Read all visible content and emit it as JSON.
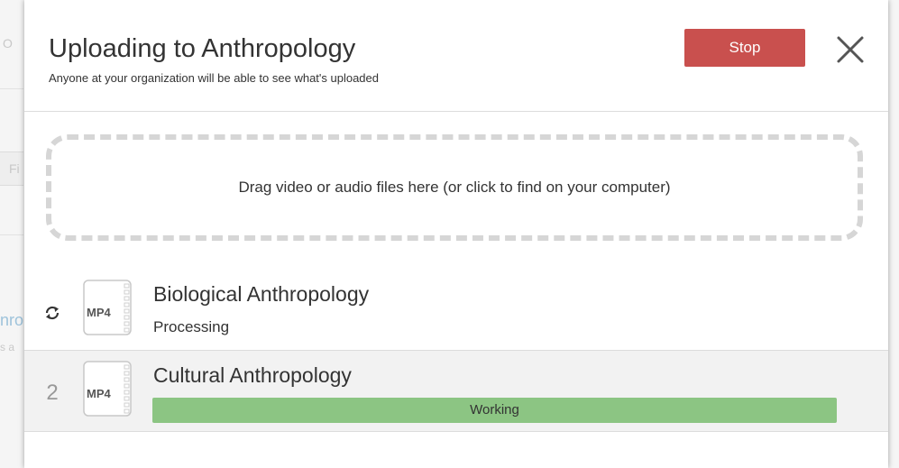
{
  "background_fragments": {
    "search_glyph": "O",
    "field_text": "Fi",
    "link_text": "nro",
    "small_text": "s a"
  },
  "dialog": {
    "title": "Uploading to Anthropology",
    "subtitle": "Anyone at your organization will be able to see what's uploaded",
    "stop_label": "Stop",
    "close_icon": "close-icon",
    "dropzone_text": "Drag video or audio files here (or click to find on your computer)"
  },
  "uploads": [
    {
      "lead_icon": "refresh-icon",
      "file_type": "MP4",
      "name": "Biological Anthropology",
      "status": "Processing"
    },
    {
      "index": "2",
      "file_type": "MP4",
      "name": "Cultural Anthropology",
      "progress_label": "Working",
      "progress": 1.0
    }
  ],
  "colors": {
    "stop_button": "#c9504e",
    "progress_fill": "#8cc583",
    "dropzone_border": "#d6d6d6",
    "text": "#333333"
  }
}
